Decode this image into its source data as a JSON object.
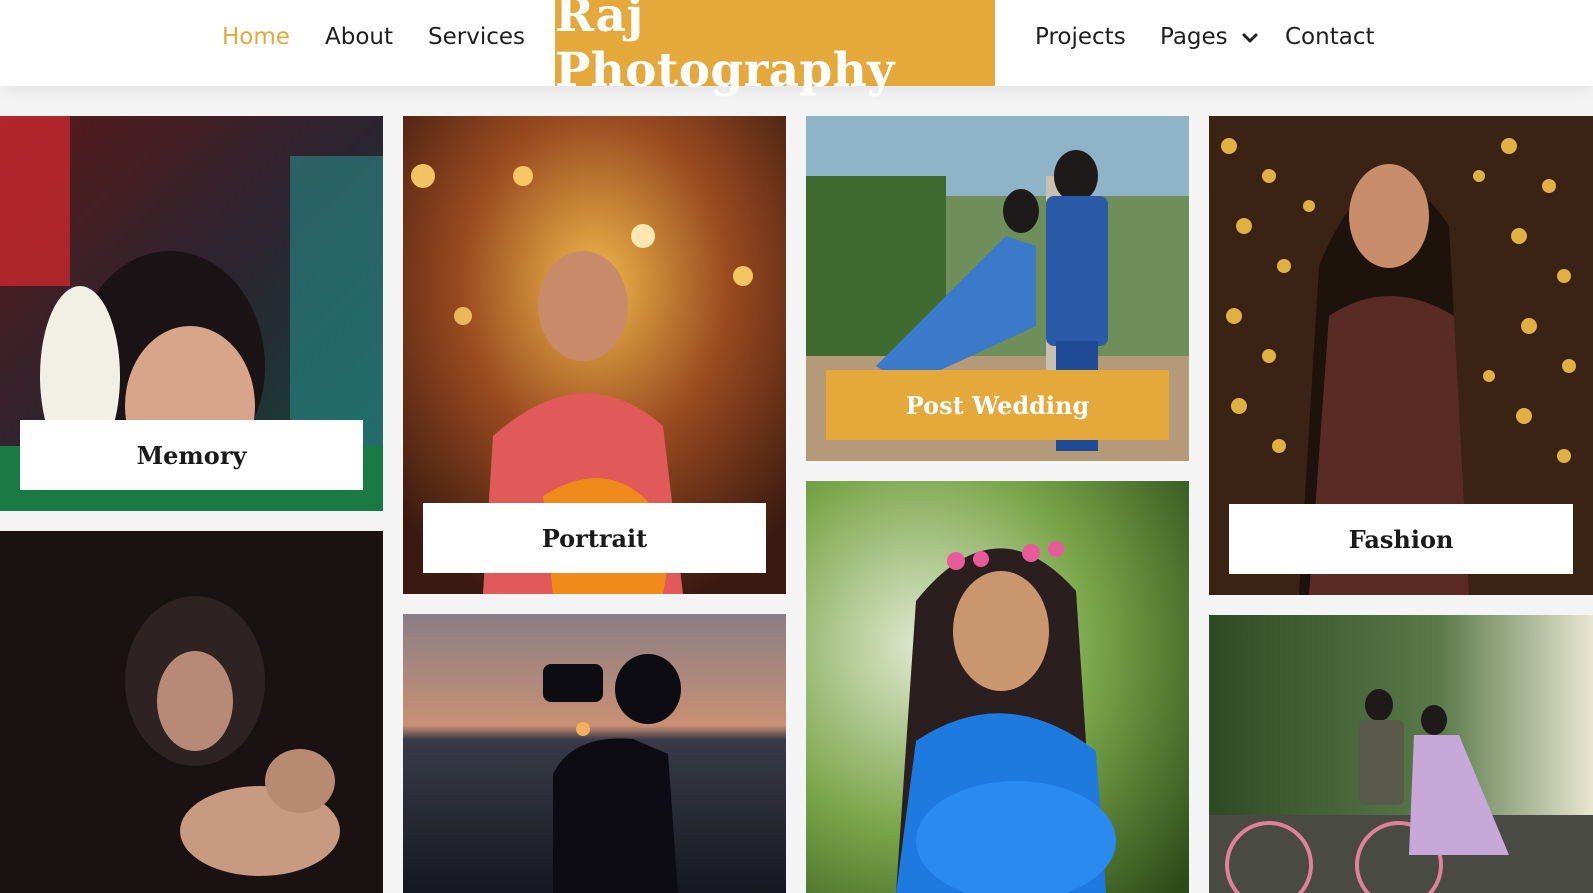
{
  "brand": {
    "name": "Raj Photography",
    "accent": "#e5a83a"
  },
  "nav": {
    "left": [
      "Home",
      "About",
      "Services"
    ],
    "right": [
      "Projects",
      "Pages",
      "Contact"
    ],
    "active": "Home"
  },
  "gallery": {
    "captions": {
      "memory": "Memory",
      "portrait": "Portrait",
      "post_wedding": "Post Wedding",
      "fashion": "Fashion"
    },
    "photos": [
      "bride-ceremony-photo",
      "bride-portrait-photo",
      "couple-outdoor-photo",
      "woman-bokeh-lights-photo",
      "mother-baby-photo",
      "photographer-silhouette-photo",
      "maternity-blue-dress-photo",
      "couple-bicycle-photo"
    ]
  }
}
